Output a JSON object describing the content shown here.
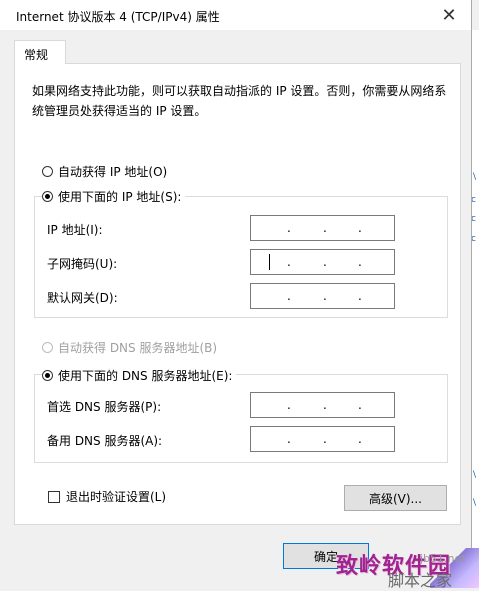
{
  "background": {
    "left_fragment_text": "网",
    "right_marks": [
      "\\",
      "c",
      "c",
      "c",
      "\\",
      "\\"
    ]
  },
  "window": {
    "title": "Internet 协议版本 4 (TCP/IPv4) 属性",
    "close_glyph": "✕"
  },
  "tab": {
    "label": "常规"
  },
  "description": "如果网络支持此功能，则可以获取自动指派的 IP 设置。否则，你需要从网络系统管理员处获得适当的 IP 设置。",
  "ip_section": {
    "auto_label": "自动获得 IP 地址(O)",
    "manual_label": "使用下面的 IP 地址(S):",
    "selected": "manual",
    "fields": [
      {
        "label": "IP 地址(I):",
        "value": ""
      },
      {
        "label": "子网掩码(U):",
        "value": ""
      },
      {
        "label": "默认网关(D):",
        "value": ""
      }
    ]
  },
  "dns_section": {
    "auto_label": "自动获得 DNS 服务器地址(B)",
    "auto_disabled": true,
    "manual_label": "使用下面的 DNS 服务器地址(E):",
    "selected": "manual",
    "fields": [
      {
        "label": "首选 DNS 服务器(P):",
        "value": ""
      },
      {
        "label": "备用 DNS 服务器(A):",
        "value": ""
      }
    ]
  },
  "validate_on_exit": {
    "label": "退出时验证设置(L)",
    "checked": false
  },
  "buttons": {
    "advanced": "高级(V)...",
    "ok": "确定"
  },
  "watermark": {
    "main": "致岭软件园",
    "domain": "jb51.net",
    "site": "脚本之家"
  },
  "colors": {
    "focus_border": "#0078d7",
    "watermark": "#a0238f"
  }
}
